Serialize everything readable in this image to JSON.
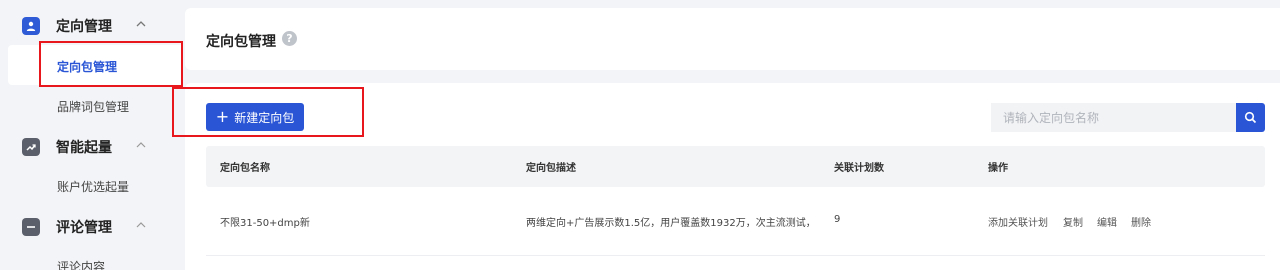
{
  "sidebar": {
    "groups": [
      {
        "title": "定向管理",
        "icon": "user-icon",
        "items": [
          "定向包管理",
          "品牌词包管理"
        ]
      },
      {
        "title": "智能起量",
        "icon": "trend-icon",
        "items": [
          "账户优选起量"
        ]
      },
      {
        "title": "评论管理",
        "icon": "comment-icon",
        "items": [
          "评论内容"
        ]
      }
    ],
    "active_item": "定向包管理"
  },
  "header": {
    "title": "定向包管理",
    "help": "?"
  },
  "toolbar": {
    "new_button_label": "新建定向包",
    "search_placeholder": "请输入定向包名称"
  },
  "table": {
    "columns": [
      "定向包名称",
      "定向包描述",
      "关联计划数",
      "操作"
    ],
    "rows": [
      {
        "name": "不限31-50+dmp新",
        "description": "两维定向+广告展示数1.5亿，用户覆盖数1932万，次主流测试，:",
        "plan_count": "9",
        "actions": [
          "添加关联计划",
          "复制",
          "编辑",
          "删除"
        ]
      }
    ]
  },
  "colors": {
    "accent": "#2a56d6",
    "annotation": "#e8171e",
    "background": "#f3f4f7"
  }
}
